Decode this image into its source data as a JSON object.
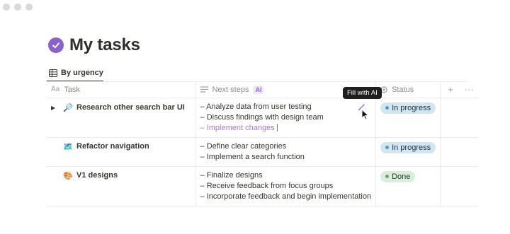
{
  "page": {
    "title": "My tasks"
  },
  "view": {
    "tab_label": "By urgency",
    "icon": "table-icon"
  },
  "columns": {
    "task": {
      "label": "Task",
      "prefix": "Aa"
    },
    "next_steps": {
      "label": "Next steps",
      "badge": "AI"
    },
    "status": {
      "label": "Status"
    },
    "add_symbol": "+",
    "more_symbol": "···"
  },
  "rows": [
    {
      "task": "Research other search bar UI",
      "emoji": "🔎",
      "steps": [
        "Analyze data from user testing",
        "Discuss findings with design team"
      ],
      "generating_step": {
        "typed": "Implement change",
        "ghost": "s"
      },
      "status": "In progress"
    },
    {
      "task": "Refactor navigation",
      "emoji": "🗺️",
      "steps": [
        "Define clear categories",
        "Implement a search function"
      ],
      "status": "In progress"
    },
    {
      "task": "V1 designs",
      "emoji": "🎨",
      "steps": [
        "Finalize designs",
        "Receive feedback from focus groups",
        "Incorporate feedback and begin implementation"
      ],
      "status": "Done"
    }
  ],
  "tooltip": {
    "text": "Fill with AI"
  },
  "colors": {
    "accent": "#8a63c7",
    "in_progress_bg": "#d3e5ef",
    "in_progress_dot": "#5b97bd",
    "done_bg": "#dbeddb",
    "done_dot": "#6c9b7d"
  }
}
